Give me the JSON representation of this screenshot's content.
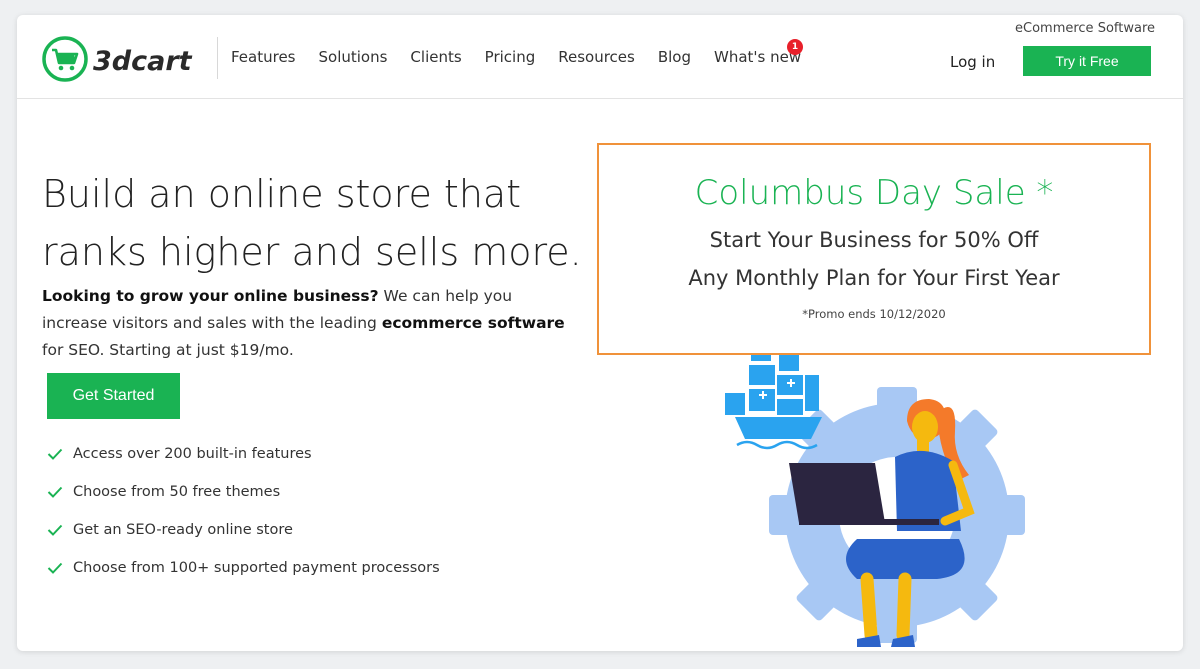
{
  "header": {
    "logo_text": "3dcart",
    "tagline": "eCommerce Software",
    "nav": [
      {
        "label": "Features"
      },
      {
        "label": "Solutions"
      },
      {
        "label": "Clients"
      },
      {
        "label": "Pricing"
      },
      {
        "label": "Resources"
      },
      {
        "label": "Blog"
      },
      {
        "label": "What's new"
      }
    ],
    "whats_new_badge": "1",
    "login_label": "Log in",
    "try_label": "Try it Free"
  },
  "hero": {
    "title_line1": "Build an online store that",
    "title_line2": "ranks higher and sells more.",
    "desc_bold1": "Looking to grow your online business?",
    "desc_text1": " We can help you increase visitors and sales with the leading ",
    "desc_bold2": "ecommerce software",
    "desc_text2": " for SEO. Starting at just $19/mo.",
    "cta_label": "Get Started",
    "features": [
      "Access over 200 built-in features",
      "Choose from 50 free themes",
      "Get an SEO-ready online store",
      "Choose from 100+ supported payment processors"
    ]
  },
  "promo": {
    "title": "Columbus Day Sale *",
    "line1": "Start Your Business for 50% Off",
    "line2": "Any Monthly Plan for Your First Year",
    "note": "*Promo ends 10/12/2020"
  },
  "colors": {
    "brand_green": "#1ab353",
    "promo_border": "#f0923a",
    "badge_red": "#e8202a"
  },
  "icons": [
    "cart-icon",
    "check-icon",
    "ship-icon"
  ]
}
